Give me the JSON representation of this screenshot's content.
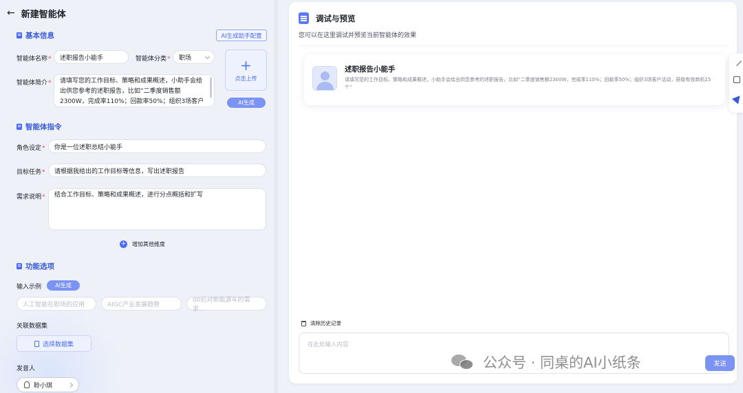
{
  "header": {
    "back_label": "←",
    "title": "新建智能体"
  },
  "basic_info": {
    "section_title": "基本信息",
    "ai_config_label": "AI生成助手配置",
    "name_label": "智能体名称",
    "name_value": "述职报告小能手",
    "category_label": "智能体分类",
    "category_value": "职场",
    "intro_label": "智能体简介",
    "intro_value": "请填写您的工作目标、策略和成果概述，小助手会给出供您参考的述职报告，比如“二季度销售额2300W，完成率110%；回款率50%；组织3场客户",
    "upload_plus": "+",
    "upload_label": "点击上传",
    "ai_generate_label": "AI生成"
  },
  "instruction": {
    "section_title": "智能体指令",
    "role_label": "角色设定",
    "role_value": "你是一位述职总结小能手",
    "goal_label": "目标任务",
    "goal_value": "请根据我给出的工作目标等信息，写出述职报告",
    "req_label": "需求说明",
    "req_value": "结合工作目标、策略和成果概述，进行分点概括和扩写",
    "add_dim_label": "增加其他维度",
    "required_mark": "*"
  },
  "features": {
    "section_title": "功能选项",
    "input_example_label": "输入示例",
    "ai_generate_label": "AI生成",
    "examples": [
      "人工智能在职场的应用",
      "AIGC产业发展趋势",
      "00后对新能源车的需求..."
    ],
    "dataset_label": "关联数据集",
    "dataset_button": "选择数据集",
    "voice_label": "发音人",
    "voice_value": "聆小琪"
  },
  "preview": {
    "title": "调试与预览",
    "subtitle": "您可以在这里调试并预览当前智能体的效果",
    "agent_name": "述职报告小能手",
    "agent_desc": "请填写您的工作目标、策略和成果概述，小助手会给出供您参考的述职报告，比如“二季度销售额2300W，完成率110%；回款率50%；组织3场客户活动，获取有效商机15个”",
    "clear_history": "清除历史记录",
    "input_placeholder": "在此处输入内容",
    "send_label": "发送"
  },
  "watermark": {
    "text": "公众号 · 同桌的AI小纸条"
  }
}
